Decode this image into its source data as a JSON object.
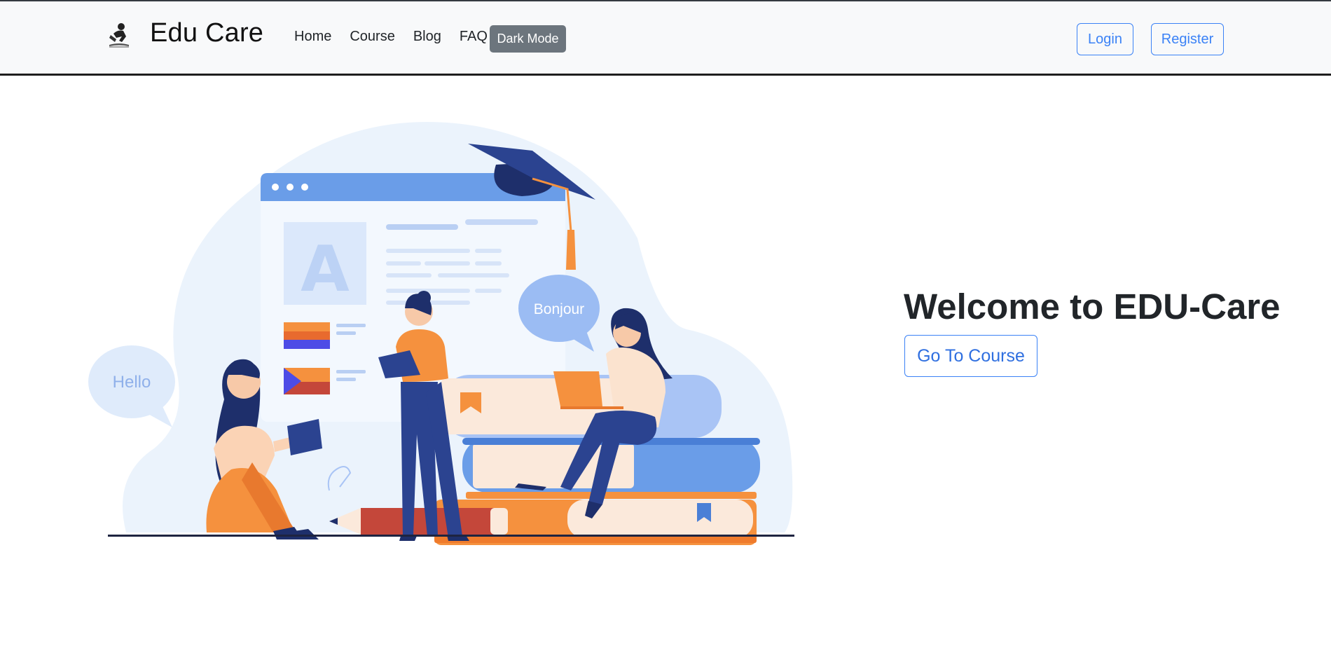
{
  "navbar": {
    "brand": "Edu Care",
    "links": [
      "Home",
      "Course",
      "Blog",
      "FAQ"
    ],
    "dark_mode_label": "Dark Mode",
    "login_label": "Login",
    "register_label": "Register"
  },
  "hero": {
    "title": "Welcome to EDU-Care",
    "cta_label": "Go To Course",
    "illustration": {
      "bubble_left": "Hello",
      "bubble_right": "Bonjour",
      "card_letter": "A"
    }
  },
  "colors": {
    "accent": "#3b82f6",
    "dark_mode_bg": "#6c757d",
    "navbar_bg": "#f8f9fa",
    "orange": "#f5913e",
    "navy": "#2b3f83",
    "light_blue": "#a9c4f5"
  }
}
